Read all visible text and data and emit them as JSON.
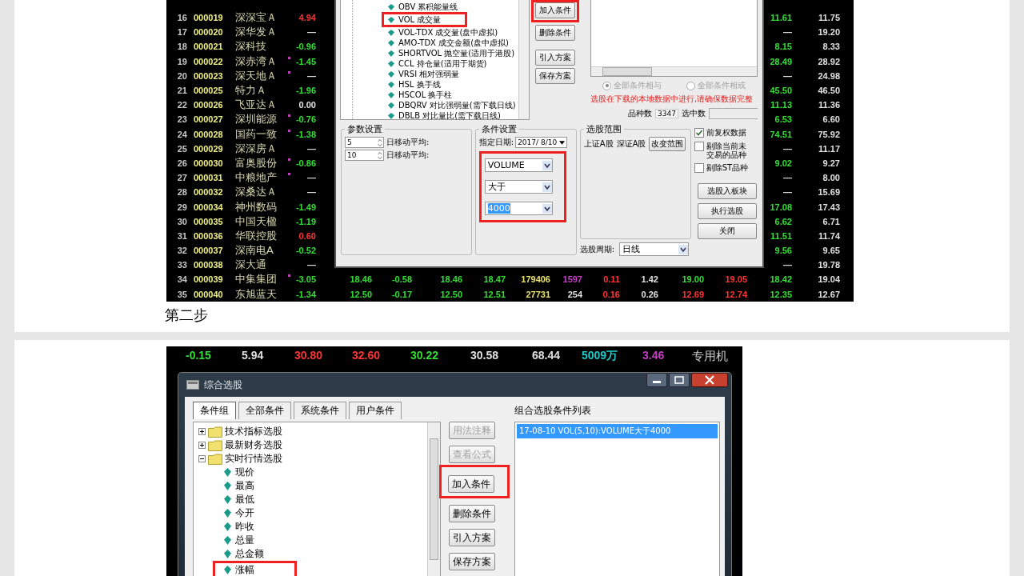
{
  "top_screenshot": {
    "rows": [
      {
        "no": "16",
        "code": "000019",
        "name": "深深宝Ａ",
        "flagged": false,
        "change": {
          "text": "4.94",
          "color": "#ff3333"
        },
        "right": [
          {
            "text": "11.61",
            "color": "#33dd33"
          },
          {
            "text": "11.75",
            "color": "#e0e0e0"
          }
        ]
      },
      {
        "no": "17",
        "code": "000020",
        "name": "深华发Ａ",
        "flagged": false,
        "change": {
          "text": "—",
          "color": "#e0e0e0"
        },
        "right": [
          {
            "text": "—",
            "color": "#e0e0e0"
          },
          {
            "text": "19.20",
            "color": "#e0e0e0"
          }
        ]
      },
      {
        "no": "18",
        "code": "000021",
        "name": "深科技",
        "flagged": false,
        "change": {
          "text": "-0.96",
          "color": "#33dd33"
        },
        "right": [
          {
            "text": "8.15",
            "color": "#33dd33"
          },
          {
            "text": "8.33",
            "color": "#e0e0e0"
          }
        ]
      },
      {
        "no": "19",
        "code": "000022",
        "name": "深赤湾Ａ",
        "flagged": true,
        "change": {
          "text": "-1.45",
          "color": "#33dd33"
        },
        "right": [
          {
            "text": "28.49",
            "color": "#33dd33"
          },
          {
            "text": "28.92",
            "color": "#e0e0e0"
          }
        ]
      },
      {
        "no": "20",
        "code": "000023",
        "name": "深天地Ａ",
        "flagged": true,
        "change": {
          "text": "—",
          "color": "#e0e0e0"
        },
        "right": [
          {
            "text": "—",
            "color": "#e0e0e0"
          },
          {
            "text": "24.98",
            "color": "#e0e0e0"
          }
        ]
      },
      {
        "no": "21",
        "code": "000025",
        "name": "特力Ａ",
        "flagged": false,
        "change": {
          "text": "-1.96",
          "color": "#33dd33"
        },
        "right": [
          {
            "text": "45.50",
            "color": "#33dd33"
          },
          {
            "text": "46.50",
            "color": "#e0e0e0"
          }
        ]
      },
      {
        "no": "22",
        "code": "000026",
        "name": "飞亚达Ａ",
        "flagged": false,
        "change": {
          "text": "0.00",
          "color": "#e0e0e0"
        },
        "right": [
          {
            "text": "11.13",
            "color": "#33dd33"
          },
          {
            "text": "11.36",
            "color": "#e0e0e0"
          }
        ]
      },
      {
        "no": "23",
        "code": "000027",
        "name": "深圳能源",
        "flagged": true,
        "change": {
          "text": "-0.76",
          "color": "#33dd33"
        },
        "right": [
          {
            "text": "6.53",
            "color": "#33dd33"
          },
          {
            "text": "6.60",
            "color": "#e0e0e0"
          }
        ]
      },
      {
        "no": "24",
        "code": "000028",
        "name": "国药一致",
        "flagged": true,
        "change": {
          "text": "-1.38",
          "color": "#33dd33"
        },
        "right": [
          {
            "text": "74.51",
            "color": "#33dd33"
          },
          {
            "text": "75.92",
            "color": "#e0e0e0"
          }
        ]
      },
      {
        "no": "25",
        "code": "000029",
        "name": "深深房Ａ",
        "flagged": false,
        "change": {
          "text": "—",
          "color": "#e0e0e0"
        },
        "right": [
          {
            "text": "—",
            "color": "#e0e0e0"
          },
          {
            "text": "11.17",
            "color": "#e0e0e0"
          }
        ]
      },
      {
        "no": "26",
        "code": "000030",
        "name": "富奥股份",
        "flagged": true,
        "change": {
          "text": "-0.86",
          "color": "#33dd33"
        },
        "right": [
          {
            "text": "9.02",
            "color": "#33dd33"
          },
          {
            "text": "9.27",
            "color": "#e0e0e0"
          }
        ]
      },
      {
        "no": "27",
        "code": "000031",
        "name": "中粮地产",
        "flagged": true,
        "change": {
          "text": "—",
          "color": "#e0e0e0"
        },
        "right": [
          {
            "text": "—",
            "color": "#e0e0e0"
          },
          {
            "text": "8.00",
            "color": "#e0e0e0"
          }
        ]
      },
      {
        "no": "28",
        "code": "000032",
        "name": "深桑达Ａ",
        "flagged": false,
        "change": {
          "text": "—",
          "color": "#e0e0e0"
        },
        "right": [
          {
            "text": "—",
            "color": "#e0e0e0"
          },
          {
            "text": "15.69",
            "color": "#e0e0e0"
          }
        ]
      },
      {
        "no": "29",
        "code": "000034",
        "name": "神州数码",
        "flagged": false,
        "change": {
          "text": "-1.49",
          "color": "#33dd33"
        },
        "right": [
          {
            "text": "17.08",
            "color": "#33dd33"
          },
          {
            "text": "17.43",
            "color": "#e0e0e0"
          }
        ]
      },
      {
        "no": "30",
        "code": "000035",
        "name": "中国天楹",
        "flagged": false,
        "change": {
          "text": "-1.19",
          "color": "#33dd33"
        },
        "right": [
          {
            "text": "6.62",
            "color": "#33dd33"
          },
          {
            "text": "6.71",
            "color": "#e0e0e0"
          }
        ]
      },
      {
        "no": "31",
        "code": "000036",
        "name": "华联控股",
        "flagged": false,
        "change": {
          "text": "0.60",
          "color": "#ff3333"
        },
        "right": [
          {
            "text": "11.51",
            "color": "#33dd33"
          },
          {
            "text": "11.74",
            "color": "#e0e0e0"
          }
        ]
      },
      {
        "no": "32",
        "code": "000037",
        "name": "深南电A",
        "flagged": false,
        "change": {
          "text": "-0.52",
          "color": "#33dd33"
        },
        "right": [
          {
            "text": "9.56",
            "color": "#33dd33"
          },
          {
            "text": "9.65",
            "color": "#e0e0e0"
          }
        ]
      },
      {
        "no": "33",
        "code": "000038",
        "name": "深大通",
        "flagged": false,
        "change": {
          "text": "—",
          "color": "#e0e0e0"
        },
        "right": [
          {
            "text": "—",
            "color": "#e0e0e0"
          },
          {
            "text": "19.78",
            "color": "#e0e0e0"
          }
        ]
      },
      {
        "no": "34",
        "code": "000039",
        "name": "中集集团",
        "flagged": true,
        "change": {
          "text": "-3.05",
          "color": "#33dd33"
        },
        "middle": [
          {
            "text": "18.46",
            "color": "#33dd33"
          },
          {
            "text": "-0.58",
            "color": "#33dd33"
          },
          {
            "text": "18.46",
            "color": "#33dd33"
          },
          {
            "text": "18.47",
            "color": "#33dd33"
          },
          {
            "text": "179406",
            "color": "#e8e070"
          },
          {
            "text": "1597",
            "color": "#c040c0"
          },
          {
            "text": "0.11",
            "color": "#ff3333"
          },
          {
            "text": "1.42",
            "color": "#e0e0e0"
          },
          {
            "text": "19.00",
            "color": "#33dd33"
          },
          {
            "text": "19.05",
            "color": "#ff3333"
          }
        ],
        "right": [
          {
            "text": "18.42",
            "color": "#33dd33"
          },
          {
            "text": "19.04",
            "color": "#e0e0e0"
          }
        ]
      },
      {
        "no": "35",
        "code": "000040",
        "name": "东旭蓝天",
        "flagged": false,
        "change": {
          "text": "-1.34",
          "color": "#33dd33"
        },
        "middle": [
          {
            "text": "12.50",
            "color": "#33dd33"
          },
          {
            "text": "-0.17",
            "color": "#33dd33"
          },
          {
            "text": "12.50",
            "color": "#33dd33"
          },
          {
            "text": "12.51",
            "color": "#33dd33"
          },
          {
            "text": "27731",
            "color": "#e8e070"
          },
          {
            "text": "254",
            "color": "#e0e0e0"
          },
          {
            "text": "0.16",
            "color": "#ff3333"
          },
          {
            "text": "0.26",
            "color": "#e0e0e0"
          },
          {
            "text": "12.69",
            "color": "#ff3333"
          },
          {
            "text": "12.74",
            "color": "#ff3333"
          }
        ],
        "right": [
          {
            "text": "12.35",
            "color": "#33dd33"
          },
          {
            "text": "12.67",
            "color": "#e0e0e0"
          }
        ]
      }
    ],
    "dialog": {
      "indicators": [
        {
          "label": "OBV 累积能量线",
          "highlighted": false
        },
        {
          "label": "VOL 成交量",
          "highlighted": true
        },
        {
          "label": "VOL-TDX 成交量(盘中虚拟)",
          "highlighted": false
        },
        {
          "label": "AMO-TDX 成交金额(盘中虚拟)",
          "highlighted": false
        },
        {
          "label": "SHORTVOL 抛空量(适用于港股)",
          "highlighted": false
        },
        {
          "label": "CCL 持仓量(适用于期货)",
          "highlighted": false
        },
        {
          "label": "VRSI 相对强弱量",
          "highlighted": false
        },
        {
          "label": "HSL 换手线",
          "highlighted": false
        },
        {
          "label": "HSCOL 换手柱",
          "highlighted": false
        },
        {
          "label": "DBQRV 对比强弱量(需下载日线)",
          "highlighted": false
        },
        {
          "label": "DBLB 对比量比(需下载日线)",
          "highlighted": false
        }
      ],
      "buttons": [
        {
          "label": "加入条件",
          "highlighted": true
        },
        {
          "label": "删除条件",
          "highlighted": false
        },
        {
          "label": "引入方案",
          "highlighted": false
        },
        {
          "label": "保存方案",
          "highlighted": false
        }
      ],
      "logic_options": [
        {
          "label": "全部条件相与",
          "selected": true
        },
        {
          "label": "全部条件相或",
          "selected": false
        }
      ],
      "notice": "选股在下载的本地数据中进行,请确保数据完整",
      "count_label": "品种数",
      "count_value": "3347",
      "selected_count_label": "选中数",
      "params": {
        "title": "参数设置",
        "rows": [
          {
            "value": "5",
            "label": "日移动平均:"
          },
          {
            "value": "10",
            "label": "日移动平均:"
          }
        ]
      },
      "conditions": {
        "title": "条件设置",
        "date_label": "指定日期:",
        "date": "2017/ 8/10",
        "highlighted": true,
        "dropdowns": [
          {
            "value": "VOLUME",
            "text_selected": false
          },
          {
            "value": "大于",
            "text_selected": false
          },
          {
            "value": "4000",
            "text_selected": true
          }
        ]
      },
      "scope": {
        "title": "选股范围",
        "markets": [
          "上证A股",
          "深证A股"
        ],
        "change_button": "改变范围",
        "period_label": "选股周期:",
        "period": "日线"
      },
      "options": [
        {
          "label": "前复权数据",
          "checked": true
        },
        {
          "label": "剔除当前未交易的品种",
          "checked": false
        },
        {
          "label": "剔除ST品种",
          "checked": false
        }
      ],
      "actions": [
        "选股入板块",
        "执行选股",
        "关闭"
      ]
    }
  },
  "step_caption": "第二步",
  "bottom_screenshot": {
    "quote_row": [
      {
        "text": "-0.15",
        "color": "#33dd33"
      },
      {
        "text": "5.94",
        "color": "#e0e0e0"
      },
      {
        "text": "30.80",
        "color": "#ff3333"
      },
      {
        "text": "32.60",
        "color": "#ff3333"
      },
      {
        "text": "30.22",
        "color": "#33dd33"
      },
      {
        "text": "30.58",
        "color": "#e0e0e0"
      },
      {
        "text": "68.44",
        "color": "#e0e0e0"
      },
      {
        "text": "5009万",
        "color": "#20c8c8"
      },
      {
        "text": "3.46",
        "color": "#c040c0"
      },
      {
        "text": "专用机",
        "color": "#c8c8c8"
      }
    ],
    "dialog": {
      "title": "综合选股",
      "tabs": [
        {
          "label": "条件组",
          "selected": true
        },
        {
          "label": "全部条件",
          "selected": false
        },
        {
          "label": "系统条件",
          "selected": false
        },
        {
          "label": "用户条件",
          "selected": false
        }
      ],
      "tree": [
        {
          "label": "技术指标选股",
          "expanded": false
        },
        {
          "label": "最新财务选股",
          "expanded": false
        },
        {
          "label": "实时行情选股",
          "expanded": true,
          "children": [
            {
              "label": "现价",
              "highlighted": false
            },
            {
              "label": "最高",
              "highlighted": false
            },
            {
              "label": "最低",
              "highlighted": false
            },
            {
              "label": "今开",
              "highlighted": false
            },
            {
              "label": "昨收",
              "highlighted": false
            },
            {
              "label": "总量",
              "highlighted": false
            },
            {
              "label": "总金额",
              "highlighted": false
            },
            {
              "label": "涨幅",
              "highlighted": true
            }
          ]
        }
      ],
      "buttons": [
        {
          "label": "用法注释",
          "disabled": true,
          "highlighted": false
        },
        {
          "label": "查看公式",
          "disabled": true,
          "highlighted": false
        },
        {
          "label": "加入条件",
          "disabled": false,
          "highlighted": true
        },
        {
          "label": "删除条件",
          "disabled": false,
          "highlighted": false
        },
        {
          "label": "引入方案",
          "disabled": false,
          "highlighted": false
        },
        {
          "label": "保存方案",
          "disabled": false,
          "highlighted": false
        }
      ],
      "list_title": "组合选股条件列表",
      "conditions": [
        {
          "text": "17-08-10 VOL(5,10):VOLUME大于4000",
          "selected": true
        }
      ]
    }
  }
}
